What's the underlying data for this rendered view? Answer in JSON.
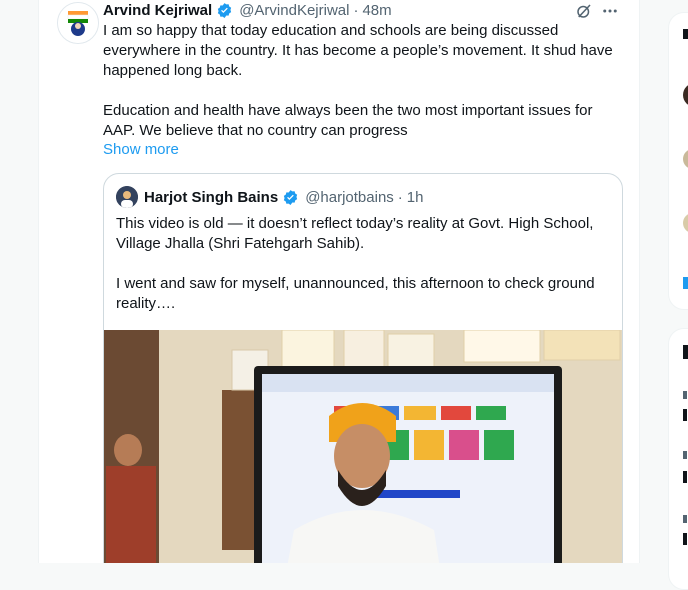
{
  "tweet": {
    "author_name": "Arvind Kejriwal",
    "handle": "@ArvindKejriwal",
    "separator": "·",
    "time": "48m",
    "text_line_1": "I am so happy that today education and schools are being discussed everywhere in the country. It has become a people’s movement. It shud have happened long back.",
    "text_line_2": "Education and health have always been the two most important issues for AAP. We believe that no country can progress",
    "show_more": "Show more"
  },
  "quoted_tweet": {
    "author_name": "Harjot Singh Bains",
    "handle": "@harjotbains",
    "separator": "·",
    "time": "1h",
    "text_line_1": "This video is old — it doesn’t reflect today’s reality at Govt. High School, Village Jhalla (Shri Fatehgarh Sahib).",
    "text_line_2": "I went and saw for myself, unannounced, this afternoon to check ground reality…."
  },
  "colors": {
    "link": "#1d9bf0",
    "verified": "#1d9bf0",
    "secondary_text": "#536471"
  },
  "icons": {
    "verified": "verified-badge-icon",
    "grok": "grok-icon",
    "more": "more-options-icon"
  }
}
